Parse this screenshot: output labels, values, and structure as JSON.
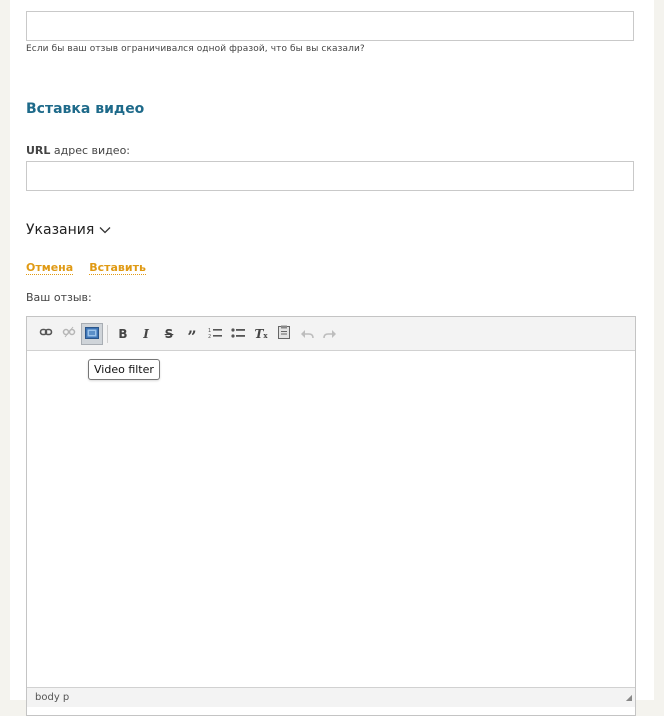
{
  "form": {
    "summary_hint": "Если бы ваш отзыв ограничивался одной фразой, что бы вы сказали?",
    "video_section_title": "Вставка видео",
    "video_url_label_prefix": "URL",
    "video_url_label_rest": " адрес видео:",
    "guidance_label": "Указания",
    "cancel_link": "Отмена",
    "insert_link": "Вставить",
    "review_label": "Ваш отзыв:"
  },
  "editor": {
    "toolbar": [
      {
        "name": "link-icon",
        "glyph": "link"
      },
      {
        "name": "unlink-icon",
        "glyph": "unlink"
      },
      {
        "name": "video-filter-icon",
        "glyph": "video",
        "active": true
      },
      {
        "name": "bold-icon",
        "glyph": "B"
      },
      {
        "name": "italic-icon",
        "glyph": "I"
      },
      {
        "name": "strikethrough-icon",
        "glyph": "S"
      },
      {
        "name": "blockquote-icon",
        "glyph": "quote"
      },
      {
        "name": "numbered-list-icon",
        "glyph": "ol"
      },
      {
        "name": "bulleted-list-icon",
        "glyph": "ul"
      },
      {
        "name": "remove-format-icon",
        "glyph": "Tx"
      },
      {
        "name": "paste-text-icon",
        "glyph": "paste"
      },
      {
        "name": "undo-icon",
        "glyph": "undo"
      },
      {
        "name": "redo-icon",
        "glyph": "redo"
      }
    ],
    "tooltip": "Video filter",
    "status_path": "body  p"
  },
  "colors": {
    "accent_title": "#1e6a8a",
    "link_orange": "#e09a14",
    "active_button": "#cfd4d9"
  }
}
